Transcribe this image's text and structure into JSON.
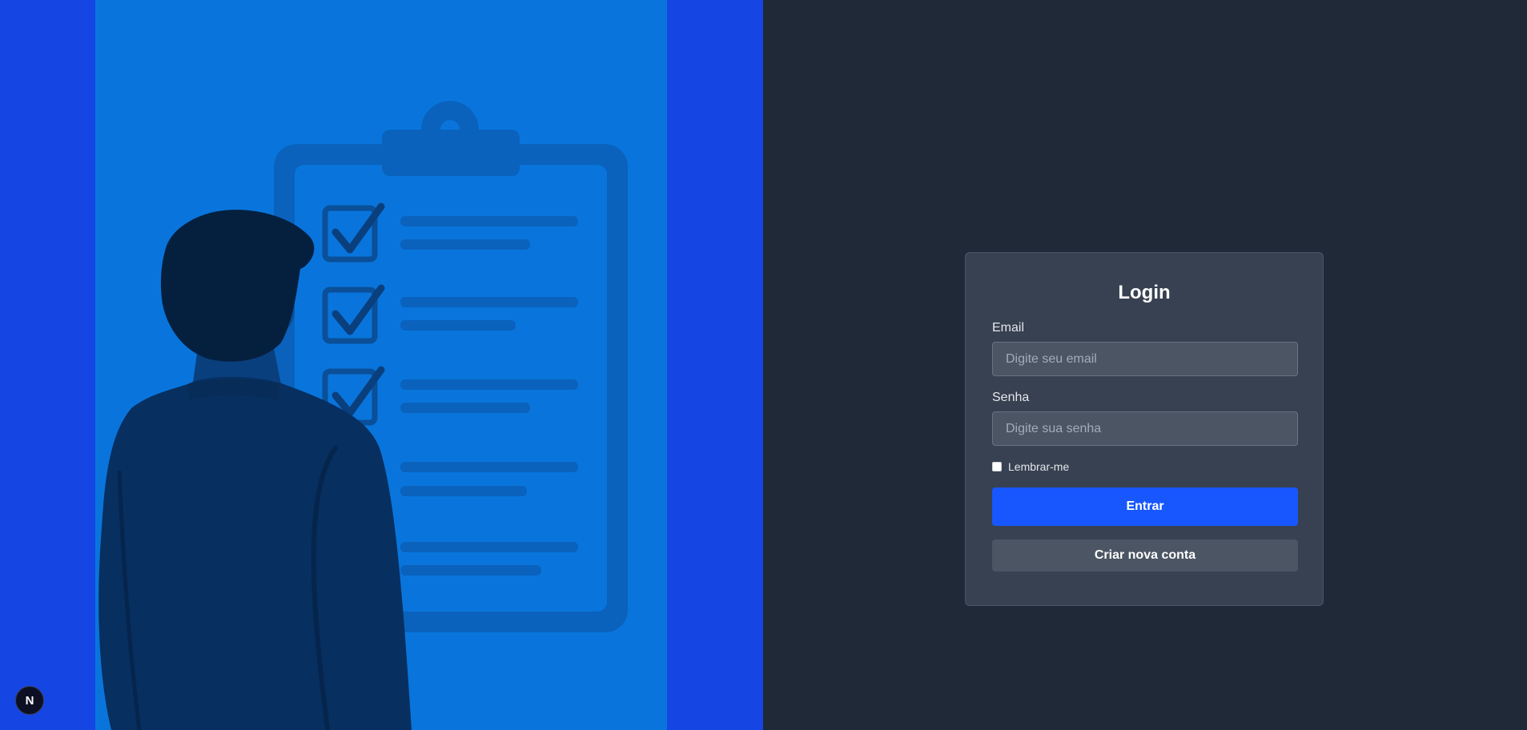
{
  "login": {
    "title": "Login",
    "email_label": "Email",
    "email_placeholder": "Digite seu email",
    "password_label": "Senha",
    "password_placeholder": "Digite sua senha",
    "remember_label": "Lembrar-me",
    "remember_checked": false,
    "submit_label": "Entrar",
    "create_account_label": "Criar nova conta"
  },
  "badge": {
    "letter": "N",
    "icon": "nextjs-logo-icon"
  },
  "illustration": {
    "icon": "clipboard-checklist-person-illustration"
  },
  "colors": {
    "left_background": "#1545e3",
    "illustration_background": "#0975dc",
    "right_background": "#1f2937",
    "card_background": "#374151",
    "input_background": "#4b5563",
    "primary": "#1757fd",
    "secondary": "#4b5563"
  }
}
